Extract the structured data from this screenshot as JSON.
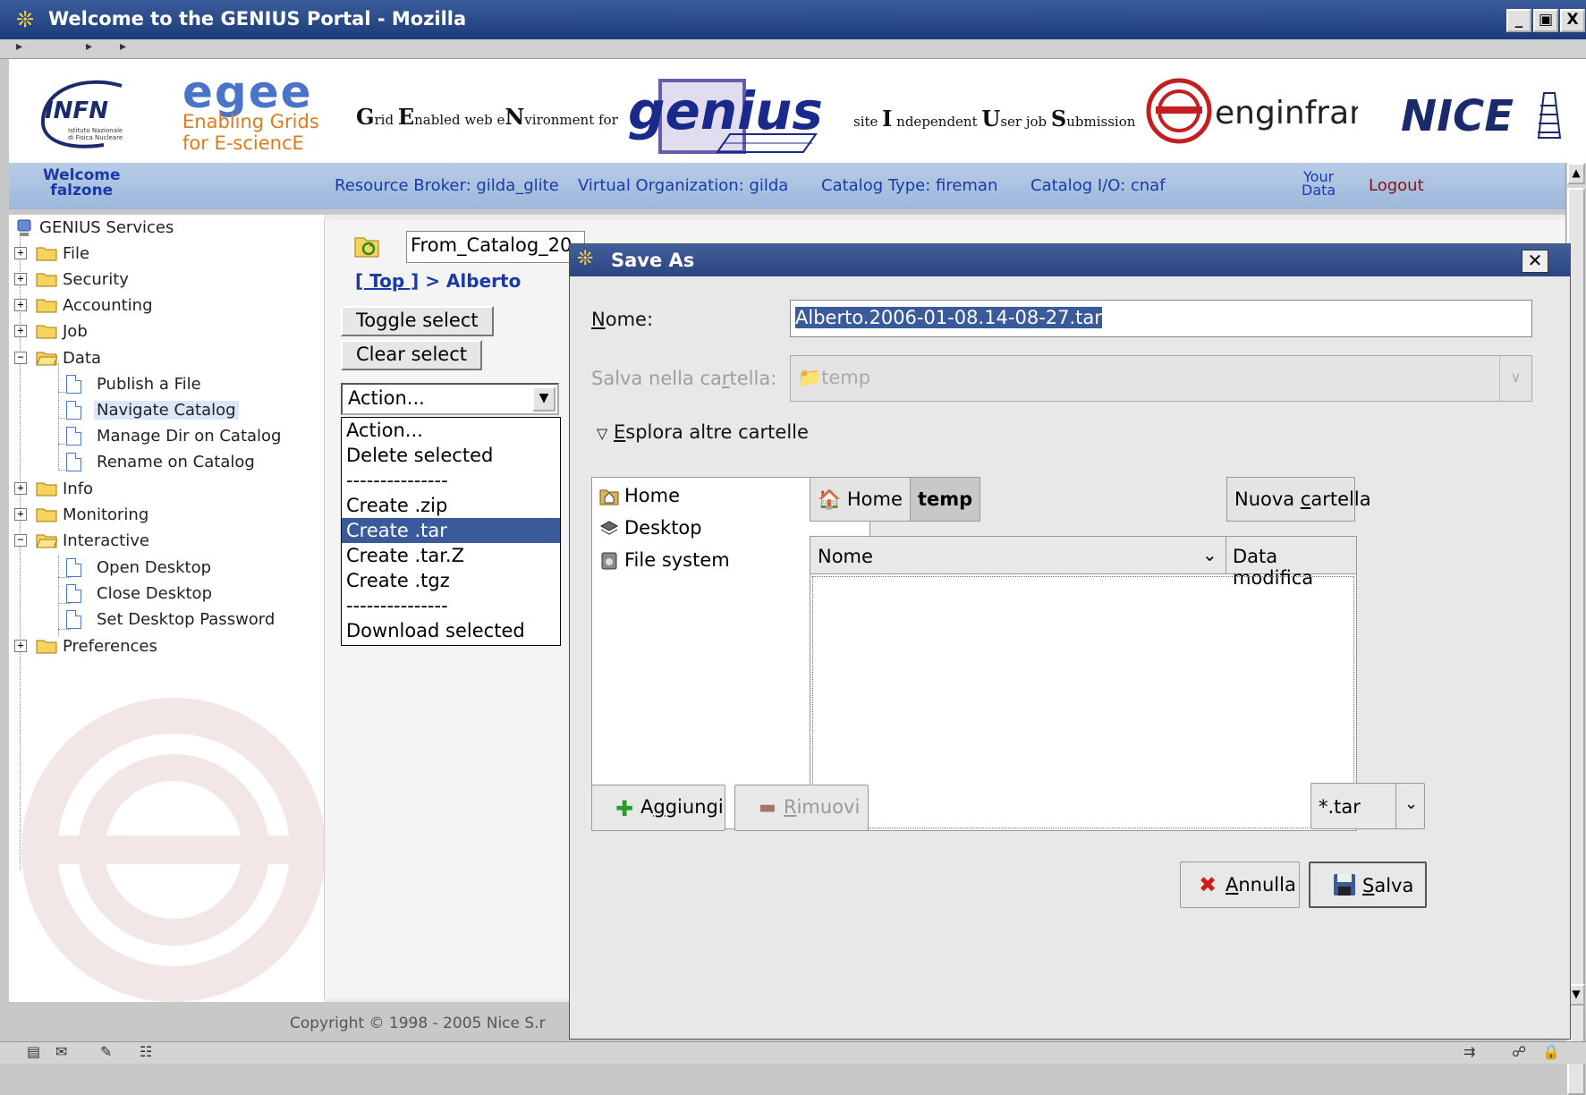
{
  "window": {
    "title": "Welcome to the GENIUS Portal - Mozilla",
    "buttons": [
      "_",
      "▣",
      "X"
    ]
  },
  "header": {
    "egee_name": "egee",
    "egee_tagline_1": "Enabling Grids",
    "egee_tagline_2": "for E-sciencE",
    "genius_acronym": {
      "g": "G",
      "g_rest": "rid ",
      "e": "E",
      "e_rest": "nabled web e",
      "n": "N",
      "n_rest": "vironment for"
    },
    "genius_logo": "genius",
    "genius_acronym_2": {
      "pre": "site ",
      "i": "I",
      "i_rest": " ndependent ",
      "u": "U",
      "u_rest": "ser job ",
      "s": "S",
      "s_rest": "ubmission"
    },
    "enginframe": "enginframe",
    "nice": "NICE"
  },
  "portal_nav": {
    "welcome_1": "Welcome",
    "welcome_2": "falzone",
    "resource_broker": "Resource Broker: gilda_glite",
    "virtual_org": "Virtual Organization: gilda",
    "catalog_type": "Catalog Type: fireman",
    "catalog_io": "Catalog I/O: cnaf",
    "your_data_1": "Your",
    "your_data_2": "Data",
    "logout": "Logout"
  },
  "sidebar": {
    "root": "GENIUS Services",
    "items": [
      {
        "label": "File"
      },
      {
        "label": "Security"
      },
      {
        "label": "Accounting"
      },
      {
        "label": "Job"
      },
      {
        "label": "Data"
      },
      {
        "label": "Publish a File"
      },
      {
        "label": "Navigate Catalog"
      },
      {
        "label": "Manage Dir on Catalog"
      },
      {
        "label": "Rename on Catalog"
      },
      {
        "label": "Info"
      },
      {
        "label": "Monitoring"
      },
      {
        "label": "Interactive"
      },
      {
        "label": "Open Desktop"
      },
      {
        "label": "Close Desktop"
      },
      {
        "label": "Set Desktop Password"
      },
      {
        "label": "Preferences"
      }
    ]
  },
  "catalog": {
    "path_value": "From_Catalog_20",
    "crumb_top": "[ Top ]",
    "crumb_rest": " > Alberto",
    "toggle_select": "Toggle select",
    "clear_select": "Clear select",
    "action_selected": "Action...",
    "action_options": [
      "Action...",
      "Delete selected",
      "---------------",
      "Create .zip",
      "Create .tar",
      "Create .tar.Z",
      "Create .tgz",
      "---------------",
      "Download selected"
    ],
    "copyright": "Copyright © 1998 - 2005 Nice S.r"
  },
  "dialog": {
    "title": "Save As",
    "name_label_u": "N",
    "name_label_rest": "ome:",
    "name_value": "Alberto.2006-01-08.14-08-27.tar",
    "folder_label_1": "Salva nella ca",
    "folder_label_u": "r",
    "folder_label_2": "tella:",
    "folder_value": "temp",
    "browse_u": "E",
    "browse_rest": "splora altre cartelle",
    "places": [
      "Home",
      "Desktop",
      "File system"
    ],
    "path_buttons": [
      "Home",
      "temp"
    ],
    "new_folder_1": "Nuova ",
    "new_folder_u": "c",
    "new_folder_2": "artella",
    "col_name": "Nome",
    "col_modified": "Data modifica",
    "add_1": "A",
    "add_u": "g",
    "add_2": "giungi",
    "remove_u": "R",
    "remove_rest": "imuovi",
    "filter": "*.tar",
    "cancel_u": "A",
    "cancel_rest": "nnulla",
    "save_u": "S",
    "save_rest": "alva"
  }
}
